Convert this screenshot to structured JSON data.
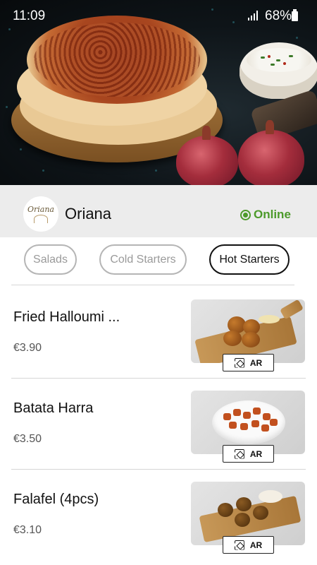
{
  "status_bar": {
    "time": "11:09",
    "battery": "68%"
  },
  "restaurant": {
    "logo_text": "Oriana",
    "name": "Oriana",
    "status": "Online"
  },
  "tabs": [
    {
      "label": "Salads",
      "active": false
    },
    {
      "label": "Cold Starters",
      "active": false
    },
    {
      "label": "Hot Starters",
      "active": true
    }
  ],
  "items": [
    {
      "name": "Fried Halloumi ...",
      "price": "€3.90",
      "ar_label": "AR"
    },
    {
      "name": "Batata Harra",
      "price": "€3.50",
      "ar_label": "AR"
    },
    {
      "name": "Falafel (4pcs)",
      "price": "€3.10",
      "ar_label": "AR"
    }
  ],
  "colors": {
    "online": "#4c9a2a",
    "active_tab_border": "#111111",
    "inactive_tab_border": "#b5b5b5"
  },
  "icons": [
    "signal-icon",
    "battery-icon",
    "online-dot-icon",
    "ar-cube-icon"
  ]
}
